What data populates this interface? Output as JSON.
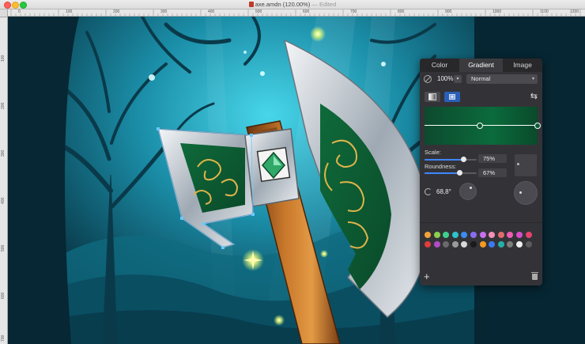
{
  "window": {
    "title": "axe.amdn (120.00%)",
    "status": "— Edited"
  },
  "rulers": {
    "top": [
      "0",
      "100",
      "200",
      "300",
      "400",
      "500",
      "600",
      "700",
      "800",
      "900",
      "1000",
      "1100",
      "1200"
    ],
    "left": [
      "100",
      "200",
      "300",
      "400",
      "500",
      "600",
      "700"
    ]
  },
  "panel": {
    "tabs": [
      "Color",
      "Gradient",
      "Image"
    ],
    "active_tab": "Gradient",
    "opacity": "100%",
    "blend_mode": "Normal",
    "gradient_colors": [
      "#0d4a2e",
      "#0b6b3c",
      "#0a4a2c"
    ],
    "scale_label": "Scale:",
    "scale_value": "75%",
    "scale_fraction": 0.75,
    "roundness_label": "Roundness:",
    "roundness_value": "67%",
    "roundness_fraction": 0.67,
    "angle_value": "68,8°",
    "swatches_row1": [
      "#f4a13a",
      "#8ccf4d",
      "#3fcf8e",
      "#2fc3c9",
      "#3b8df2",
      "#8a6cf0",
      "#c86ff0",
      "#f58fb8",
      "#e06b6b",
      "#f25bb5",
      "#d94cc9",
      "#e5426e"
    ],
    "swatches_row2": [
      "#e23c3c",
      "#b04cc4",
      "#6a6a6a",
      "#9a9a9a",
      "#d8d8d8",
      "#1a1a1a",
      "#f59a23",
      "#3a7bf2",
      "#23b0a8",
      "#7d7d7d",
      "#f0f0f0",
      "#5c5c5c"
    ]
  }
}
